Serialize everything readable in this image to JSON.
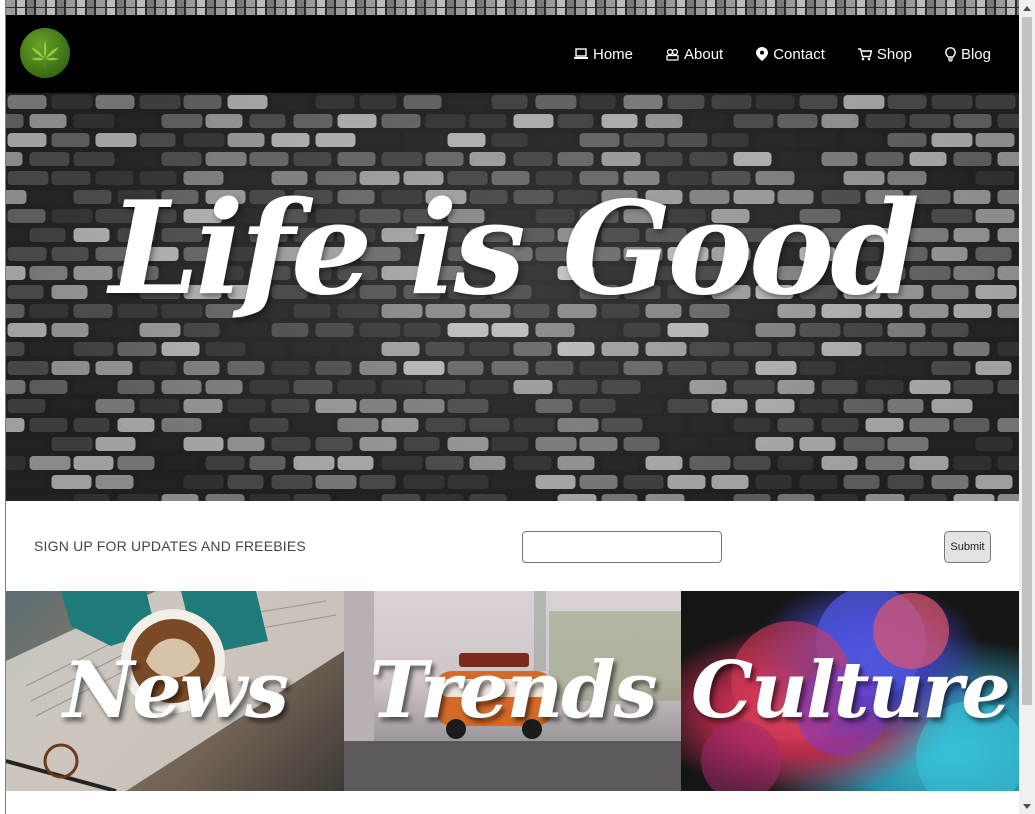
{
  "nav": {
    "items": [
      {
        "label": "Home",
        "icon": "laptop-icon"
      },
      {
        "label": "About",
        "icon": "group-icon"
      },
      {
        "label": "Contact",
        "icon": "location-pin-icon"
      },
      {
        "label": "Shop",
        "icon": "cart-icon"
      },
      {
        "label": "Blog",
        "icon": "lightbulb-icon"
      }
    ]
  },
  "hero": {
    "title": "Life is Good"
  },
  "signup": {
    "label": "SIGN UP FOR UPDATES AND FREEBIES",
    "input_value": "",
    "submit_label": "Submit"
  },
  "tiles": [
    {
      "label": "News"
    },
    {
      "label": "Trends"
    },
    {
      "label": "Culture"
    }
  ],
  "colors": {
    "navbar_bg": "#000000",
    "logo_green": "#3f7417",
    "text_white": "#ffffff"
  }
}
